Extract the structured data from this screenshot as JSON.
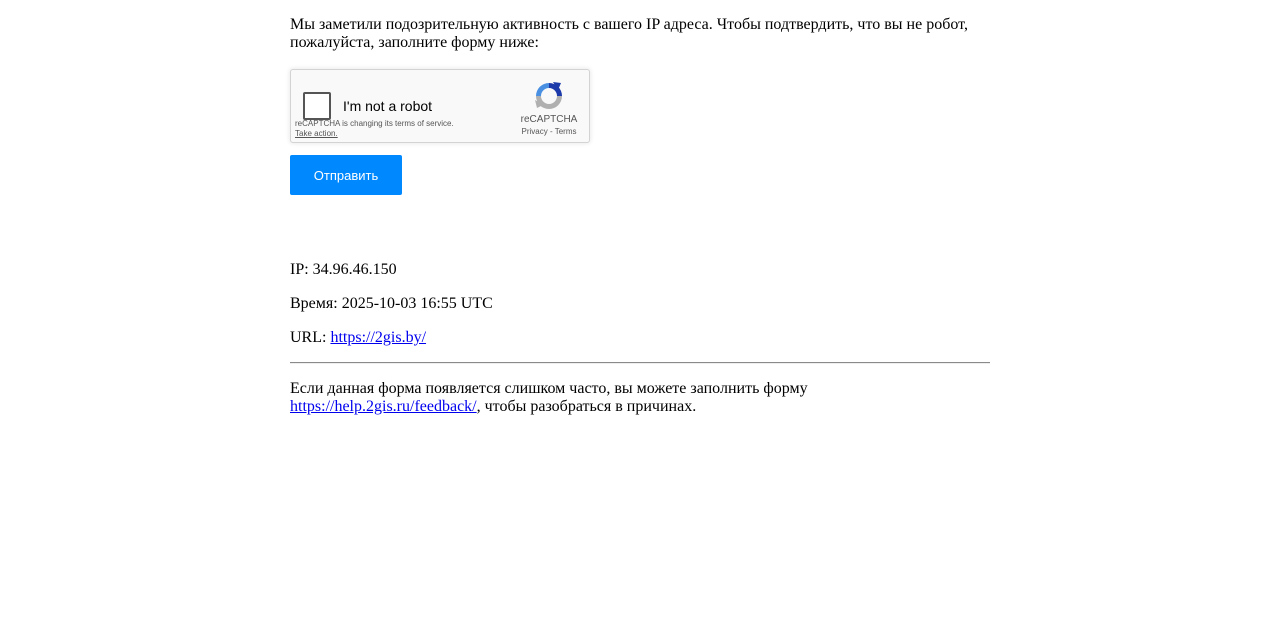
{
  "intro_text": "Мы заметили подозрительную активность с вашего IP адреса. Чтобы подтвердить, что вы не робот, пожалуйста, заполните форму ниже:",
  "captcha": {
    "label": "I'm not a robot",
    "notice": "reCAPTCHA is changing its terms of service.",
    "take_action": "Take action.",
    "brand": "reCAPTCHA",
    "privacy": "Privacy",
    "separator": " - ",
    "terms": "Terms",
    "logo_icon": "recaptcha-logo-icon",
    "colors": {
      "blue": "#1c3aa9",
      "lightblue": "#4a90e2",
      "gray": "#b0b0b0"
    }
  },
  "submit_label": "Отправить",
  "info": {
    "ip_label": "IP: ",
    "ip_value": "34.96.46.150",
    "time_label": "Время: ",
    "time_value": "2025-10-03 16:55 UTC",
    "url_label": "URL: ",
    "url_value": "https://2gis.by/"
  },
  "footer": {
    "text_before": "Если данная форма появляется слишком часто, вы можете заполнить форму ",
    "link": "https://help.2gis.ru/feedback/",
    "text_after": ", чтобы разобраться в причинах."
  },
  "colors": {
    "button_bg": "#0088ff",
    "link": "#0000ee"
  }
}
